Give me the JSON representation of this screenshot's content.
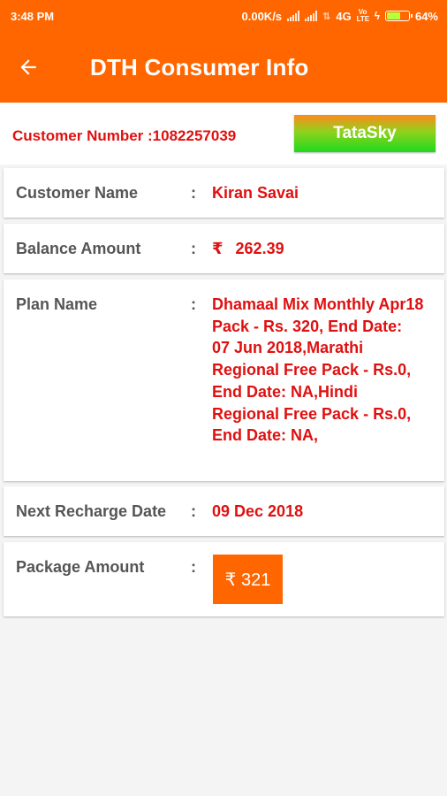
{
  "status_bar": {
    "time": "3:48 PM",
    "network_speed": "0.00K/s",
    "network_type": "4G",
    "volte": "Vo LTE",
    "battery": "64%"
  },
  "app_bar": {
    "title": "DTH Consumer Info",
    "back_icon": "arrow-left-icon"
  },
  "customer": {
    "number_label": "Customer Number :1082257039",
    "operator": "TataSky"
  },
  "details": {
    "customer_name": {
      "label": "Customer Name",
      "colon": ":",
      "value": "Kiran Savai"
    },
    "balance": {
      "label": "Balance Amount",
      "colon": ":",
      "currency": "₹",
      "value": "262.39"
    },
    "plan": {
      "label": "Plan Name",
      "colon": ":",
      "value": "Dhamaal Mix Monthly Apr18 Pack - Rs. 320,  End Date: 07 Jun 2018,Marathi Regional Free Pack - Rs.0,  End Date: NA,Hindi Regional Free Pack - Rs.0,  End Date: NA,"
    },
    "next_recharge": {
      "label": "Next Recharge Date",
      "colon": ":",
      "value": "09 Dec 2018"
    },
    "package": {
      "label": "Package Amount",
      "colon": ":",
      "button": "₹ 321"
    }
  },
  "colors": {
    "primary": "#ff6600",
    "value_red": "#e01010",
    "label_gray": "#555555",
    "operator_gradient": [
      "#ff8a1c",
      "#1fd91f"
    ]
  }
}
